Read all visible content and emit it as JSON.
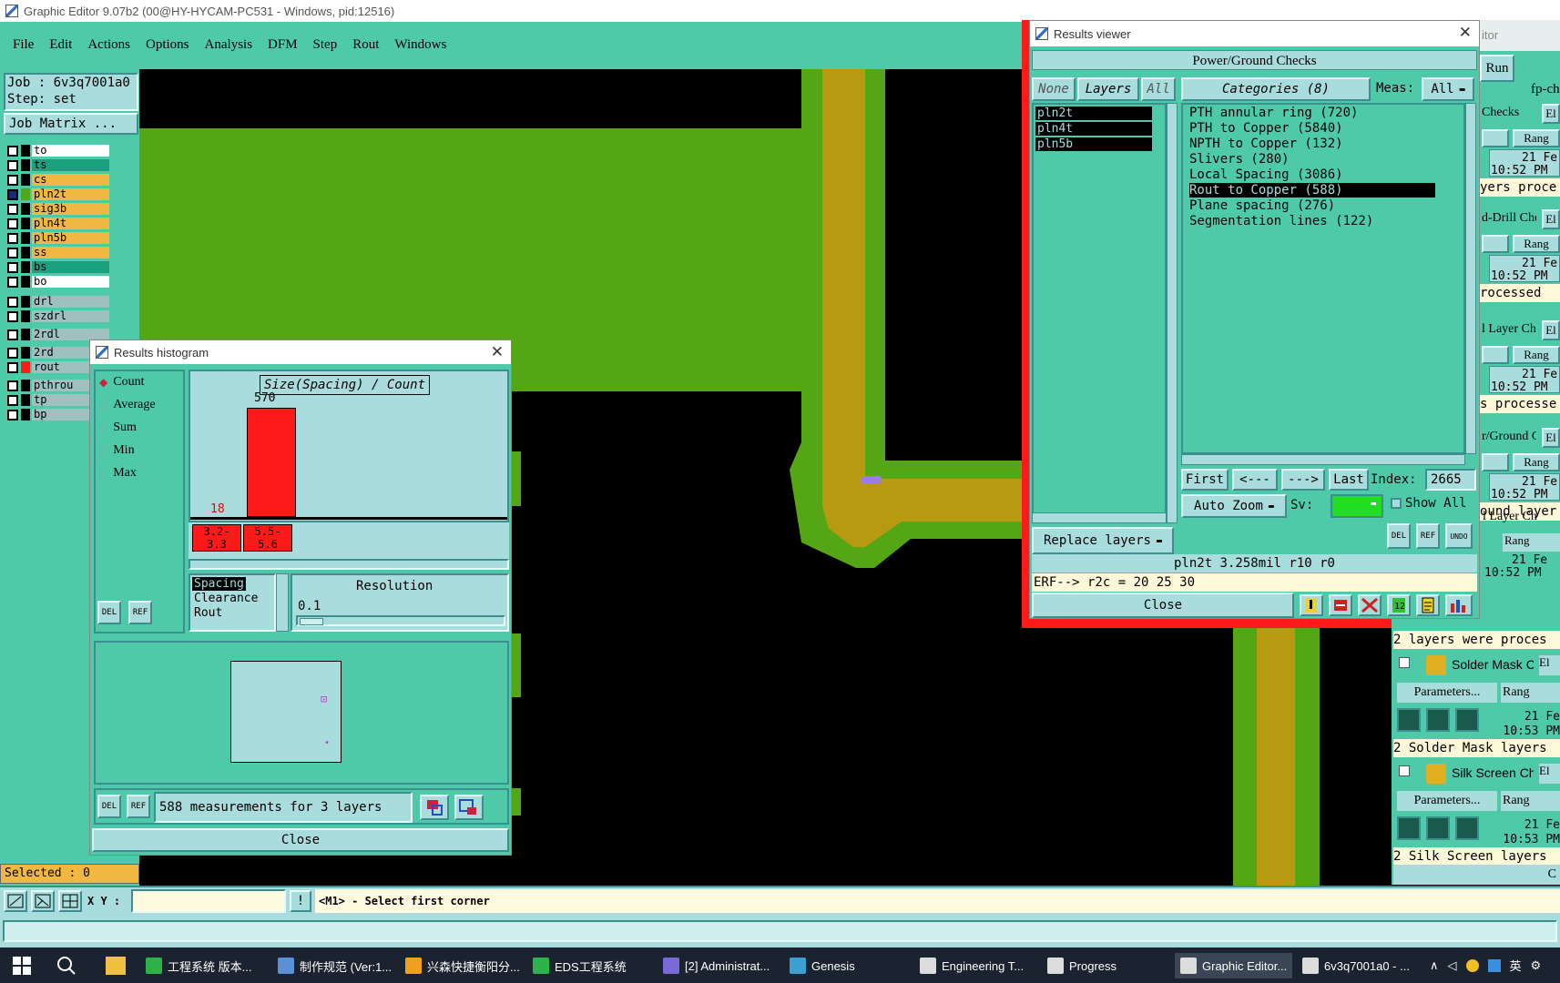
{
  "window": {
    "title": "Graphic Editor 9.07b2 (00@HY-HYCAM-PC531 - Windows, pid:12516)"
  },
  "menu": [
    "File",
    "Edit",
    "Actions",
    "Options",
    "Analysis",
    "DFM",
    "Step",
    "Rout",
    "Windows"
  ],
  "left": {
    "job": "Job : 6v3q7001a0",
    "step": "Step: set",
    "job_matrix": "Job Matrix ...",
    "layers": [
      {
        "name": "to",
        "color": "#ffffff"
      },
      {
        "name": "ts",
        "color": "#1aa07e"
      },
      {
        "name": "cs",
        "color": "#f0b840"
      },
      {
        "name": "pln2t",
        "color": "#f0b840"
      },
      {
        "name": "sig3b",
        "color": "#f0b840"
      },
      {
        "name": "pln4t",
        "color": "#f0b840"
      },
      {
        "name": "pln5b",
        "color": "#f0b840"
      },
      {
        "name": "ss",
        "color": "#f0b840"
      },
      {
        "name": "bs",
        "color": "#1aa07e"
      },
      {
        "name": "bo",
        "color": "#ffffff"
      },
      {
        "name": "drl",
        "color": "#9ec0c0"
      },
      {
        "name": "szdrl",
        "color": "#9ec0c0"
      },
      {
        "name": "2rdl",
        "color": "#9ec0c0"
      },
      {
        "name": "2rd",
        "color": "#9ec0c0"
      },
      {
        "name": "rout",
        "color": "#9ec0c0"
      },
      {
        "name": "pthrou",
        "color": "#9ec0c0"
      },
      {
        "name": "tp",
        "color": "#9ec0c0"
      },
      {
        "name": "bp",
        "color": "#9ec0c0"
      }
    ],
    "selected": "Selected : 0"
  },
  "histogram": {
    "title": "Results histogram",
    "options": [
      "Count",
      "Average",
      "Sum",
      "Min",
      "Max"
    ],
    "chart_title": "Size(Spacing) / Count",
    "bar_values": [
      "18",
      "570"
    ],
    "bins": [
      [
        "3.2-",
        "3.3"
      ],
      [
        "5.5-",
        "5.6"
      ]
    ],
    "list": [
      "Spacing",
      "Clearance",
      "Rout"
    ],
    "resolution_label": "Resolution",
    "resolution_value": "0.1",
    "summary": "588 measurements for 3 layers",
    "close": "Close",
    "del": "DEL",
    "ref": "REF"
  },
  "results": {
    "title": "Results viewer",
    "header": "Power/Ground Checks",
    "none": "None",
    "layers_btn": "Layers",
    "all": "All",
    "layers": [
      "pln2t",
      "pln4t",
      "pln5b"
    ],
    "categories_btn": "Categories (8)",
    "meas_label": "Meas:",
    "meas_value": "All",
    "categories": [
      "PTH annular ring (720)",
      "PTH to Copper (5840)",
      "NPTH to Copper (132)",
      "Slivers (280)",
      "Local Spacing (3086)",
      "Rout to Copper (588)",
      "Plane spacing (276)",
      "Segmentation lines (122)"
    ],
    "first": "First",
    "prev": "<---",
    "next": "--->",
    "last": "Last",
    "index_label": "Index:",
    "index_value": "2665",
    "auto_zoom": "Auto Zoom",
    "sv": "Sv:",
    "show_all": "Show All",
    "replace_layers": "Replace layers",
    "status": "pln2t 3.258mil  r10  r0",
    "erf": "ERF--> r2c = 20 25 30",
    "close": "Close",
    "del": "DEL",
    "ref": "REF",
    "undo": "UNDO"
  },
  "right_panel": {
    "itor": "itor",
    "run": "Run",
    "fpc": "fp-ch",
    "rows": [
      {
        "name": "Checks",
        "el": "El",
        "range": "Rang",
        "date": "21 Fe",
        "time": "10:52 PM",
        "msg": "yers proce"
      },
      {
        "name": "d-Drill Che",
        "el": "El",
        "range": "Rang",
        "date": "21 Fe",
        "time": "10:52 PM",
        "msg": "rocessed"
      },
      {
        "name": "l Layer Ch",
        "el": "El",
        "range": "Rang",
        "date": "21 Fe",
        "time": "10:52 PM",
        "msg": "s processe"
      },
      {
        "name": "r/Ground C",
        "el": "El",
        "range": "Rang",
        "date": "21 Fe",
        "time": "10:52 PM",
        "msg": "ound layer"
      },
      {
        "name": "l Layer Ch",
        "el": "El",
        "range": "Rang",
        "date": "21 Fe",
        "time": "10:52 PM",
        "msg": "2 layers were proces"
      }
    ],
    "solder": {
      "name": "Solder Mask Ch",
      "el": "El",
      "params": "Parameters...",
      "range": "Rang",
      "date": "21 Fe",
      "time": "10:53 PM",
      "msg": "2 Solder Mask layers"
    },
    "silk": {
      "name": "Silk Screen Che",
      "el": "El",
      "params": "Parameters...",
      "range": "Rang",
      "date": "21 Fe",
      "time": "10:53 PM",
      "msg": "2 Silk Screen layers"
    },
    "bottom": "C"
  },
  "bottom": {
    "xy_label": "X Y :",
    "xy_value": "",
    "info_btn": "!",
    "hint": "<M1> - Select first corner"
  },
  "taskbar": {
    "items": [
      {
        "label": "工程系统  版本...",
        "color": "#2db34a"
      },
      {
        "label": "制作规范 (Ver:1...",
        "color": "#5b8fd6"
      },
      {
        "label": "兴森快捷衡阳分...",
        "color": "#f0a020"
      },
      {
        "label": "EDS工程系统",
        "color": "#2db34a"
      },
      {
        "label": "[2] Administrat...",
        "color": "#7a6ad8"
      },
      {
        "label": "Genesis",
        "color": "#3aa0d0"
      },
      {
        "label": "Engineering T...",
        "color": "#dcdcdc"
      },
      {
        "label": "Progress",
        "color": "#dcdcdc"
      },
      {
        "label": "Graphic Editor...",
        "color": "#dcdcdc"
      },
      {
        "label": "6v3q7001a0 - ...",
        "color": "#dcdcdc"
      }
    ],
    "ime": "英"
  },
  "colors": {
    "teal": "#4fcaa8",
    "pale": "#a9dcdc",
    "copper_green": "#55a615",
    "copper_gold": "#b79a10",
    "highlight_red": "#ff1a1a"
  }
}
